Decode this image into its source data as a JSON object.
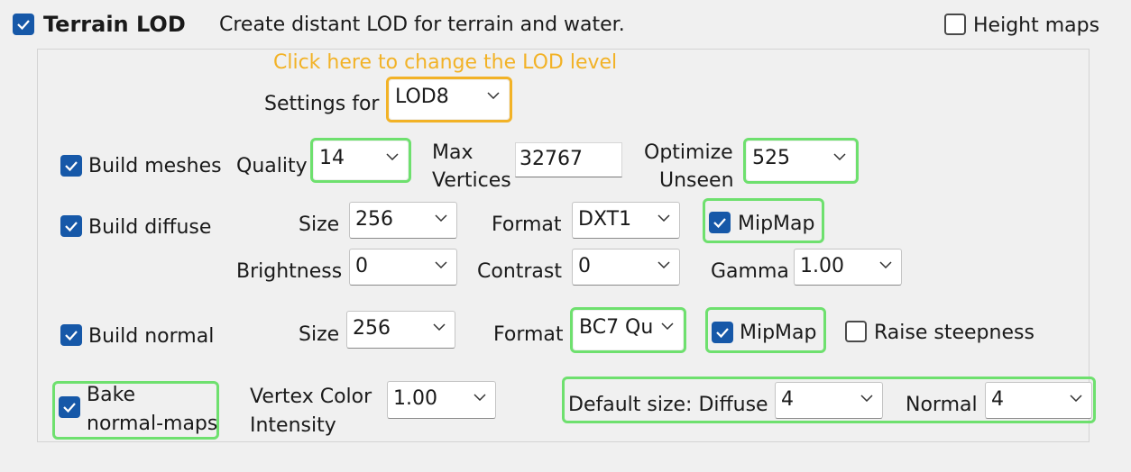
{
  "header": {
    "terrain_lod_label": "Terrain LOD",
    "description": "Create distant LOD for terrain and water.",
    "height_maps_label": "Height maps"
  },
  "hint": {
    "text": "Click here to change the LOD level",
    "color": "#f2b226"
  },
  "settings_for": {
    "label": "Settings for",
    "value": "LOD8"
  },
  "meshes": {
    "label": "Build meshes",
    "quality_label": "Quality",
    "quality_value": "14",
    "max_vertices_label_1": "Max",
    "max_vertices_label_2": "Vertices",
    "max_vertices_value": "32767",
    "optimize_label_1": "Optimize",
    "optimize_label_2": "Unseen",
    "optimize_value": "525"
  },
  "diffuse": {
    "label": "Build diffuse",
    "size_label": "Size",
    "size_value": "256",
    "format_label": "Format",
    "format_value": "DXT1",
    "mipmap_label": "MipMap",
    "brightness_label": "Brightness",
    "brightness_value": "0",
    "contrast_label": "Contrast",
    "contrast_value": "0",
    "gamma_label": "Gamma",
    "gamma_value": "1.00"
  },
  "normal": {
    "label": "Build normal",
    "size_label": "Size",
    "size_value": "256",
    "format_label": "Format",
    "format_value": "BC7 Qu",
    "mipmap_label": "MipMap",
    "raise_steepness_label": "Raise steepness"
  },
  "bake": {
    "label_1": "Bake",
    "label_2": "normal-maps",
    "vertex_color_label_1": "Vertex Color",
    "vertex_color_label_2": "Intensity",
    "vertex_color_value": "1.00",
    "default_size_label": "Default size: Diffuse",
    "default_diffuse_value": "4",
    "normal_label": "Normal",
    "default_normal_value": "4"
  },
  "colors": {
    "accent": "#1658a8",
    "highlight_green": "#6ee06e",
    "highlight_orange": "#f2b226"
  }
}
